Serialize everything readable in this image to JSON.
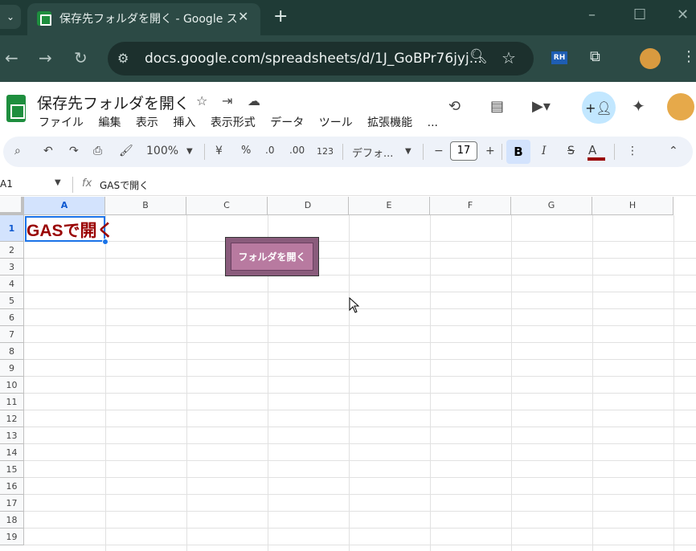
{
  "browser": {
    "tab_title": "保存先フォルダを開く - Google ス",
    "url": "docs.google.com/spreadsheets/d/1J_GoBPr76jyj...",
    "ext_label": "RH"
  },
  "sheet": {
    "title": "保存先フォルダを開く",
    "menu": [
      "ファイル",
      "編集",
      "表示",
      "挿入",
      "表示形式",
      "データ",
      "ツール",
      "拡張機能",
      "..."
    ]
  },
  "toolbar": {
    "zoom": "100%",
    "currency": "¥",
    "percent": "%",
    "dec_decrease": ".0",
    "dec_increase": ".00",
    "number_format": "123",
    "font": "デフォ...",
    "font_size": "17",
    "bold": "B",
    "italic": "I",
    "text_color_letter": "A",
    "text_color": "#990000"
  },
  "formula_bar": {
    "name_box": "A1",
    "fx": "fx",
    "value": "GASで開く"
  },
  "grid": {
    "columns": [
      "A",
      "B",
      "C",
      "D",
      "E",
      "F",
      "G",
      "H"
    ],
    "rows": [
      "1",
      "2",
      "3",
      "4",
      "5",
      "6",
      "7",
      "8",
      "9",
      "10",
      "11",
      "12",
      "13",
      "14",
      "15",
      "16",
      "17",
      "18",
      "19"
    ],
    "selected_cell": "A1",
    "a1_value": "GASで開く"
  },
  "drawing_button": {
    "label": "フォルダを開く"
  }
}
